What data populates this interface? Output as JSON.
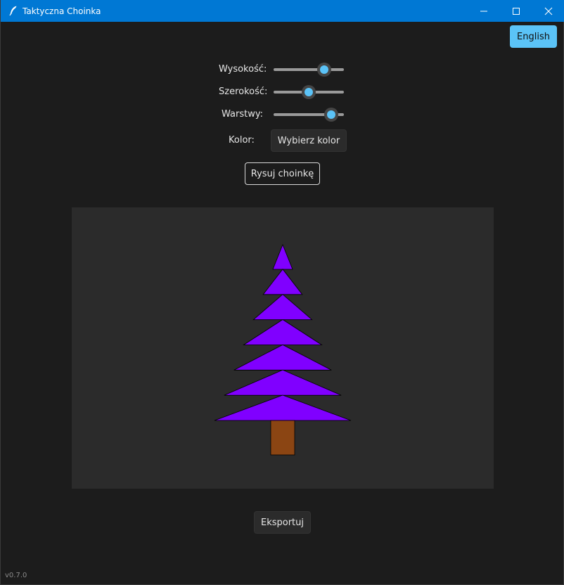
{
  "window": {
    "title": "Taktyczna Choinka",
    "icon": "feather-icon",
    "controls": [
      "minimize-icon",
      "maximize-icon",
      "close-icon"
    ]
  },
  "language_button": "English",
  "controls": {
    "height_label": "Wysokość:",
    "height_value": 0.72,
    "width_label": "Szerokość:",
    "width_value": 0.5,
    "layers_label": "Warstwy:",
    "layers_value": 0.82,
    "color_label": "Kolor:",
    "color_button": "Wybierz kolor"
  },
  "draw_button": "Rysuj choinkę",
  "tree": {
    "layer_count": 7,
    "foliage_color": "#8000ff",
    "trunk_color": "#8b4513",
    "background_color": "#2b2b2b"
  },
  "export_button": "Eksportuj",
  "version": "v0.7.0",
  "colors": {
    "accent": "#5bc3f7",
    "titlebar": "#0078d4",
    "background": "#1c1c1c"
  }
}
